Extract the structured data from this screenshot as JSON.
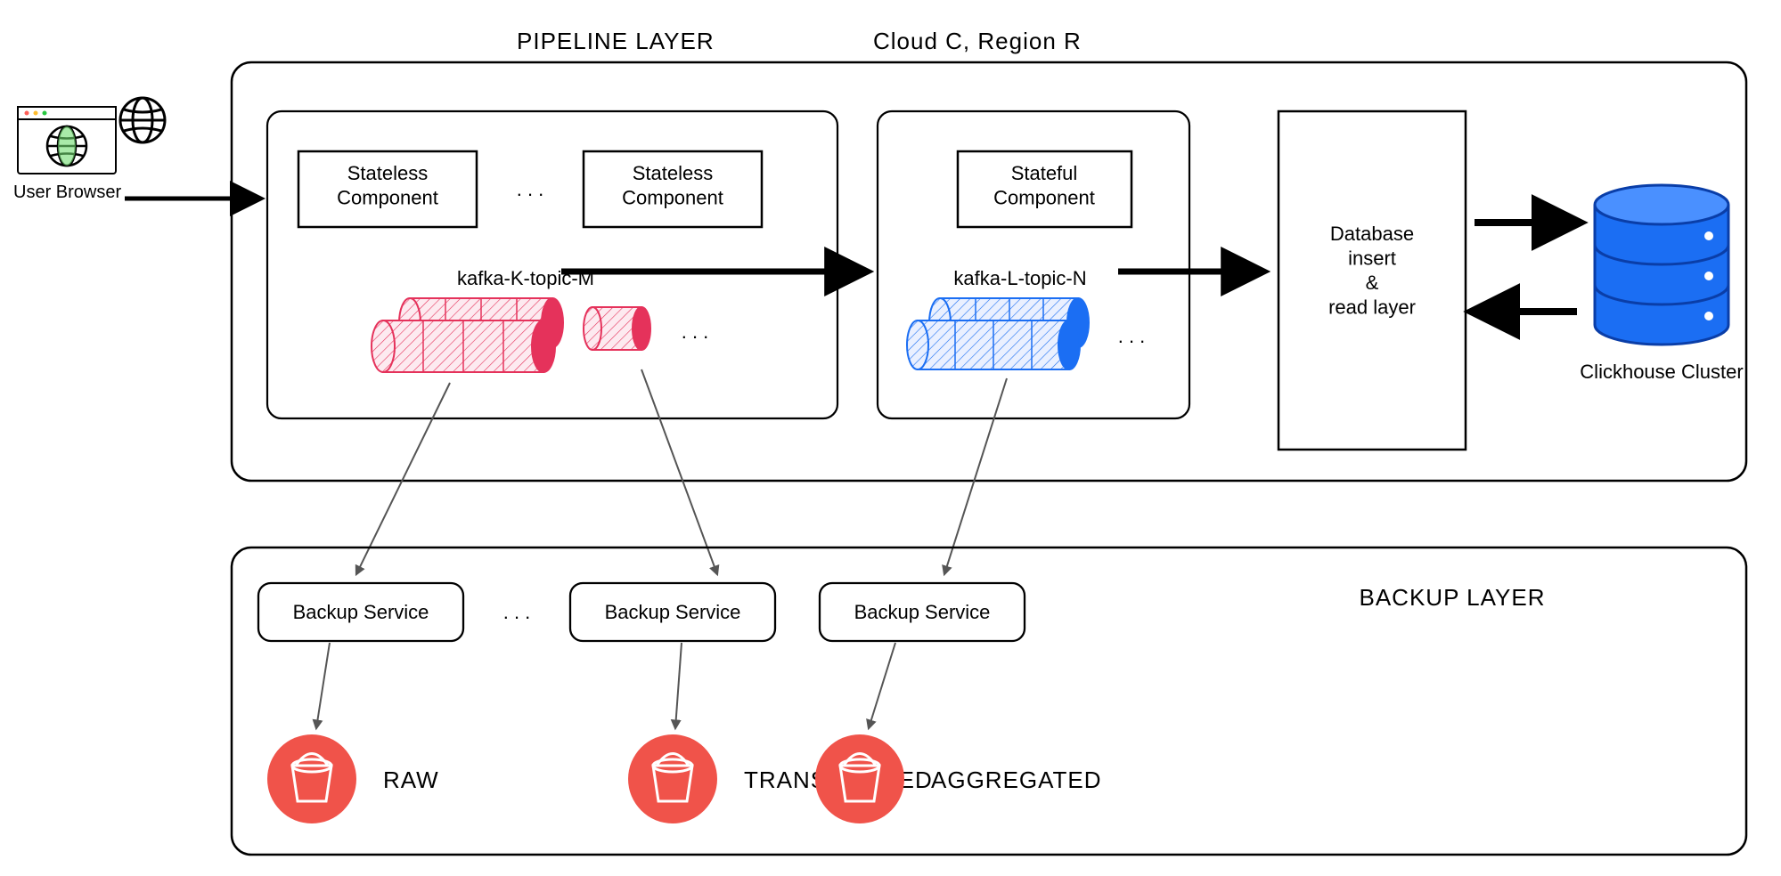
{
  "titles": {
    "pipeline": "PIPELINE LAYER",
    "region": "Cloud C, Region R",
    "backup": "BACKUP LAYER"
  },
  "userBrowser": {
    "label": "User Browser"
  },
  "stateless": {
    "left": "Stateless\nComponent",
    "right": "Stateless\nComponent",
    "ellipsis": ". . ."
  },
  "kafka": {
    "m_label": "kafka-K-topic-M",
    "m_ellipsis": ". . .",
    "n_label": "kafka-L-topic-N",
    "n_ellipsis": ". . ."
  },
  "stateful": {
    "label": "Stateful\nComponent"
  },
  "dbLayer": {
    "label": "Database\ninsert\n&\nread layer"
  },
  "clickhouse": {
    "label": "Clickhouse Cluster"
  },
  "backupServices": {
    "s1": "Backup Service",
    "s2": "Backup Service",
    "s3": "Backup Service",
    "ellipsis": ". . ."
  },
  "buckets": {
    "raw": "RAW",
    "transformed": "TRANSFORMED",
    "aggregated": "AGGREGATED"
  },
  "colors": {
    "crimson": "#e5325b",
    "blue": "#1b6ef3",
    "bucketRed": "#f0534a"
  }
}
